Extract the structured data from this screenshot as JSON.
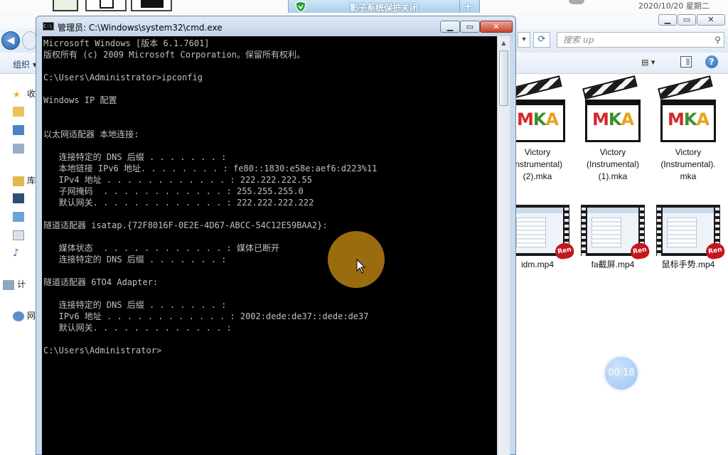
{
  "top_strip": {
    "shadow_title": "影子系统保护关闭",
    "datetime": "2020/10/20 星期二"
  },
  "explorer": {
    "search_placeholder": "搜索 up",
    "toolbar_organize": "组织 ▾",
    "nav_items": [
      "收",
      "库",
      "计",
      "网"
    ],
    "files": [
      {
        "name": "Victory (Instrumental) (2).mka",
        "label_lines": [
          "Victory",
          "Instrumental)",
          "(2).mka"
        ],
        "type": "mka"
      },
      {
        "name": "Victory (Instrumental) (1).mka",
        "label_lines": [
          "Victory",
          "(Instrumental)",
          "(1).mka"
        ],
        "type": "mka"
      },
      {
        "name": "Victory (Instrumental).mka",
        "label_lines": [
          "Victory",
          "(Instrumental).",
          "mka"
        ],
        "type": "mka"
      },
      {
        "name": "idm.mp4",
        "label_lines": [
          "idm.mp4"
        ],
        "type": "mp4"
      },
      {
        "name": "fa截屏.mp4",
        "label_lines": [
          "fa截屏.mp4"
        ],
        "type": "mp4"
      },
      {
        "name": "鼠标手势.mp4",
        "label_lines": [
          "鼠标手势.mp4"
        ],
        "type": "mp4"
      }
    ],
    "mka_text": {
      "m": "M",
      "k": "K",
      "a": "A"
    },
    "video_badge": "Ren"
  },
  "cmd": {
    "title": "管理员: C:\\Windows\\system32\\cmd.exe",
    "icon_text": "C:\\",
    "output": "Microsoft Windows [版本 6.1.7601]\n版权所有 (c) 2009 Microsoft Corporation。保留所有权利。\n\nC:\\Users\\Administrator>ipconfig\n\nWindows IP 配置\n\n\n以太网适配器 本地连接:\n\n   连接特定的 DNS 后缀 . . . . . . . :\n   本地链接 IPv6 地址. . . . . . . . : fe80::1830:e58e:aef6:d223%11\n   IPv4 地址 . . . . . . . . . . . . : 222.222.222.55\n   子网掩码  . . . . . . . . . . . . : 255.255.255.0\n   默认网关. . . . . . . . . . . . . : 222.222.222.222\n\n隧道适配器 isatap.{72F8016F-0E2E-4D67-ABCC-54C12E59BAA2}:\n\n   媒体状态  . . . . . . . . . . . . : 媒体已断开\n   连接特定的 DNS 后缀 . . . . . . . :\n\n隧道适配器 6TO4 Adapter:\n\n   连接特定的 DNS 后缀 . . . . . . . :\n   IPv6 地址 . . . . . . . . . . . . : 2002:dede:de37::dede:de37\n   默认网关. . . . . . . . . . . . . :\n\nC:\\Users\\Administrator>",
    "controls": {
      "minimize": "▁",
      "maximize": "▭",
      "close": "✕"
    }
  },
  "overlay": {
    "timer": "00:18",
    "cursor_color": "#b07a12"
  },
  "colors": {
    "console_bg": "#000000",
    "console_text": "#c0c0c0",
    "titlebar": "#c9daed"
  }
}
